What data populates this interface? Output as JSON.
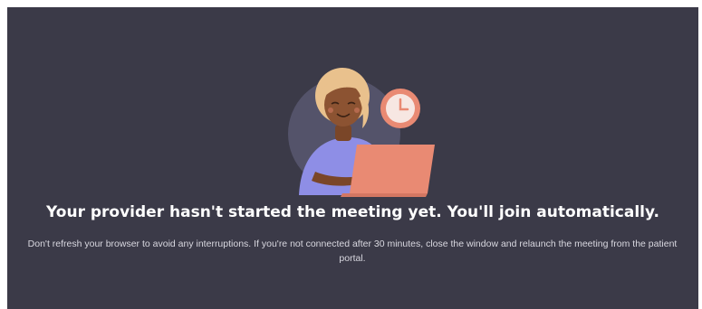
{
  "waiting_room": {
    "headline": "Your provider hasn't started the meeting yet. You'll join automatically.",
    "subtext_line1": "Don't refresh your browser to avoid any interruptions. If you're not connected after 30 minutes, close the window and relaunch the meeting from the patient",
    "subtext_line2": "portal.",
    "illustration": {
      "person_icon": "person-with-laptop-icon",
      "clock_icon": "clock-icon"
    }
  },
  "colors": {
    "background": "#3b3a48",
    "circle": "#54536a",
    "hair": "#e9c18d",
    "skin": "#8c5332",
    "shirt": "#8e8ee6",
    "laptop": "#e98a73",
    "clock_ring": "#e98a73",
    "headline_text": "#ffffff",
    "subtext_text": "#d9d8e0"
  }
}
